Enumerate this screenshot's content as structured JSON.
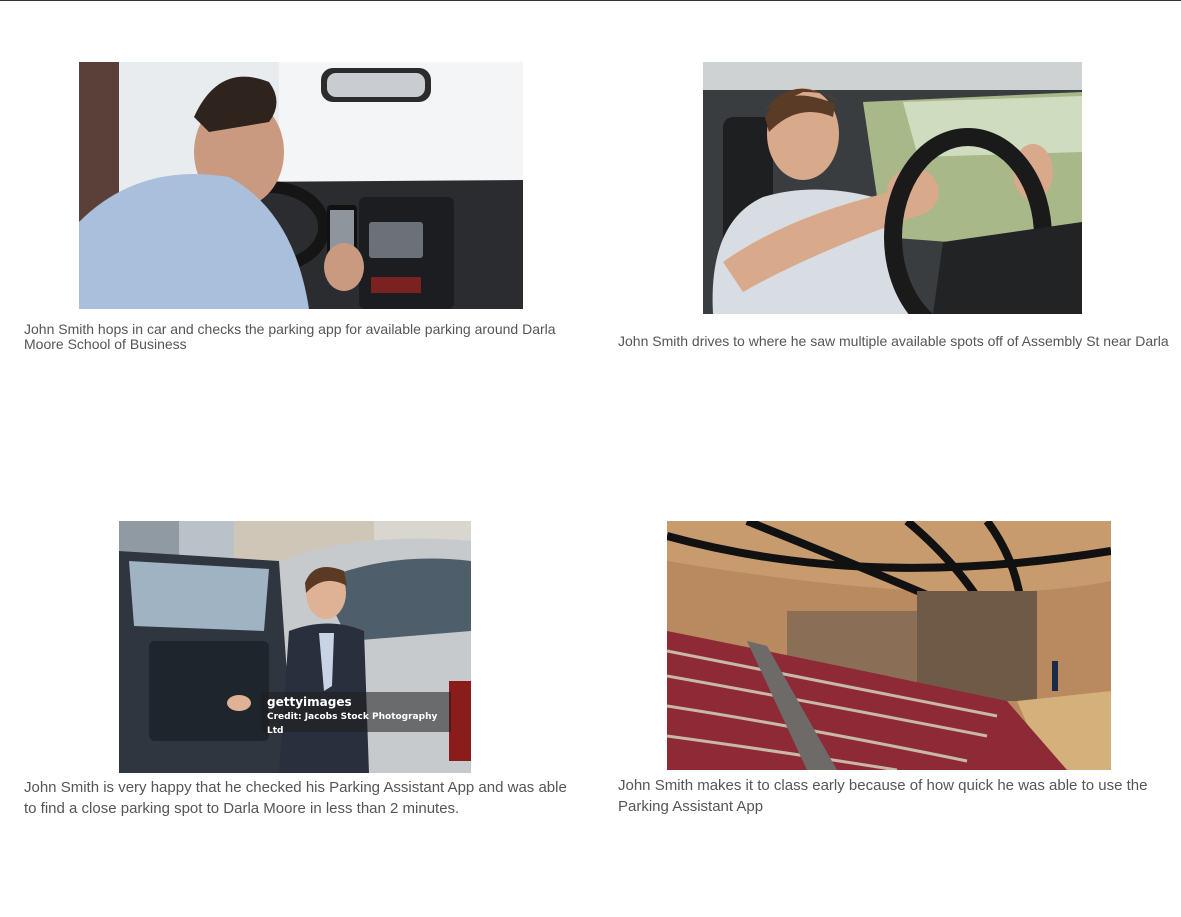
{
  "storyboard": {
    "panels": [
      {
        "image_subject": "man-checking-phone-in-car",
        "caption": "John Smith hops in car and checks the parking app for available parking around Darla Moore School of Business"
      },
      {
        "image_subject": "young-man-driving",
        "caption": "John Smith drives to where he saw multiple available spots off of Assembly St near Darla"
      },
      {
        "image_subject": "businessman-exiting-car",
        "caption": "John Smith is very happy that he checked his Parking Assistant App and was able to find a close parking spot to Darla Moore in less than 2 minutes.",
        "watermark_brand": "gettyimages",
        "watermark_credit": "Credit: Jacobs Stock Photography Ltd"
      },
      {
        "image_subject": "lecture-hall",
        "caption": "John Smith makes it to class early because of how quick he was able to use the Parking Assistant App"
      }
    ]
  },
  "colors": {
    "caption_text": "#555555",
    "top_rule": "#333333",
    "seat_red": "#8e2a35"
  }
}
